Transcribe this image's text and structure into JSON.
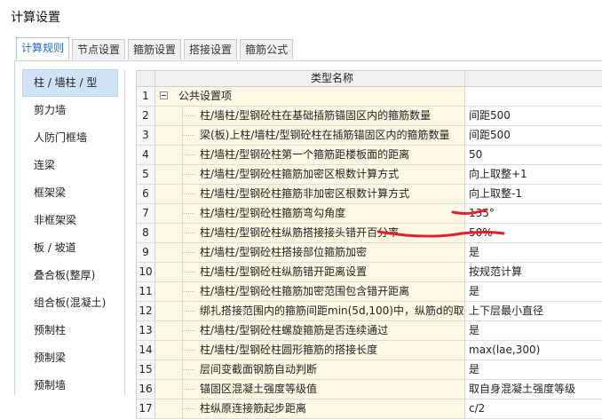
{
  "window": {
    "title": "计算设置"
  },
  "tabs": [
    {
      "label": "计算规则",
      "active": true
    },
    {
      "label": "节点设置"
    },
    {
      "label": "箍筋设置"
    },
    {
      "label": "搭接设置"
    },
    {
      "label": "箍筋公式"
    }
  ],
  "sidebar": {
    "items": [
      {
        "label": "柱 / 墙柱 / 型",
        "active": true
      },
      {
        "label": "剪力墙"
      },
      {
        "label": "人防门框墙"
      },
      {
        "label": "连梁"
      },
      {
        "label": "框架梁"
      },
      {
        "label": "非框架梁"
      },
      {
        "label": "板 / 坡道"
      },
      {
        "label": "叠合板(整厚)"
      },
      {
        "label": "组合板(混凝土)"
      },
      {
        "label": "预制柱"
      },
      {
        "label": "预制梁"
      },
      {
        "label": "预制墙"
      }
    ]
  },
  "table": {
    "header": "类型名称",
    "rows": [
      {
        "num": "1",
        "name": "公共设置项",
        "value": "",
        "group": true
      },
      {
        "num": "2",
        "name": "柱/墙柱/型钢砼柱在基础插筋锚固区内的箍筋数量",
        "value": "间距500"
      },
      {
        "num": "3",
        "name": "梁(板)上柱/墙柱/型钢砼柱在插筋锚固区内的箍筋数量",
        "value": "间距500"
      },
      {
        "num": "4",
        "name": "柱/墙柱/型钢砼柱第一个箍筋距楼板面的距离",
        "value": "50"
      },
      {
        "num": "5",
        "name": "柱/墙柱/型钢砼柱箍筋加密区根数计算方式",
        "value": "向上取整+1"
      },
      {
        "num": "6",
        "name": "柱/墙柱/型钢砼柱箍筋非加密区根数计算方式",
        "value": "向上取整-1"
      },
      {
        "num": "7",
        "name": "柱/墙柱/型钢砼柱箍筋弯勾角度",
        "value": "135°"
      },
      {
        "num": "8",
        "name": "柱/墙柱/型钢砼柱纵筋搭接接头错开百分率",
        "value": "50%"
      },
      {
        "num": "9",
        "name": "柱/墙柱/型钢砼柱搭接部位箍筋加密",
        "value": "是"
      },
      {
        "num": "10",
        "name": "柱/墙柱/型钢砼柱纵筋错开距离设置",
        "value": "按规范计算"
      },
      {
        "num": "11",
        "name": "柱/墙柱/型钢砼柱箍筋加密范围包含错开距离",
        "value": "是"
      },
      {
        "num": "12",
        "name": "绑扎搭接范围内的箍筋间距min(5d,100)中，纵筋d的取值",
        "value": "上下层最小直径"
      },
      {
        "num": "13",
        "name": "柱/墙柱/型钢砼柱螺旋箍筋是否连续通过",
        "value": "是"
      },
      {
        "num": "14",
        "name": "柱/墙柱/型钢砼柱圆形箍筋的搭接长度",
        "value": "max(lae,300)"
      },
      {
        "num": "15",
        "name": "层间变截面钢筋自动判断",
        "value": "是"
      },
      {
        "num": "16",
        "name": "锚固区混凝土强度等级值",
        "value": "取自身混凝土强度等级"
      },
      {
        "num": "17",
        "name": "柱纵原连接筋起步距离",
        "value": "c/2"
      }
    ]
  },
  "colors": {
    "annotation": "#e0202a",
    "name_cell_bg": "#fdf8e4",
    "active_tab_text": "#1f6fbf"
  }
}
